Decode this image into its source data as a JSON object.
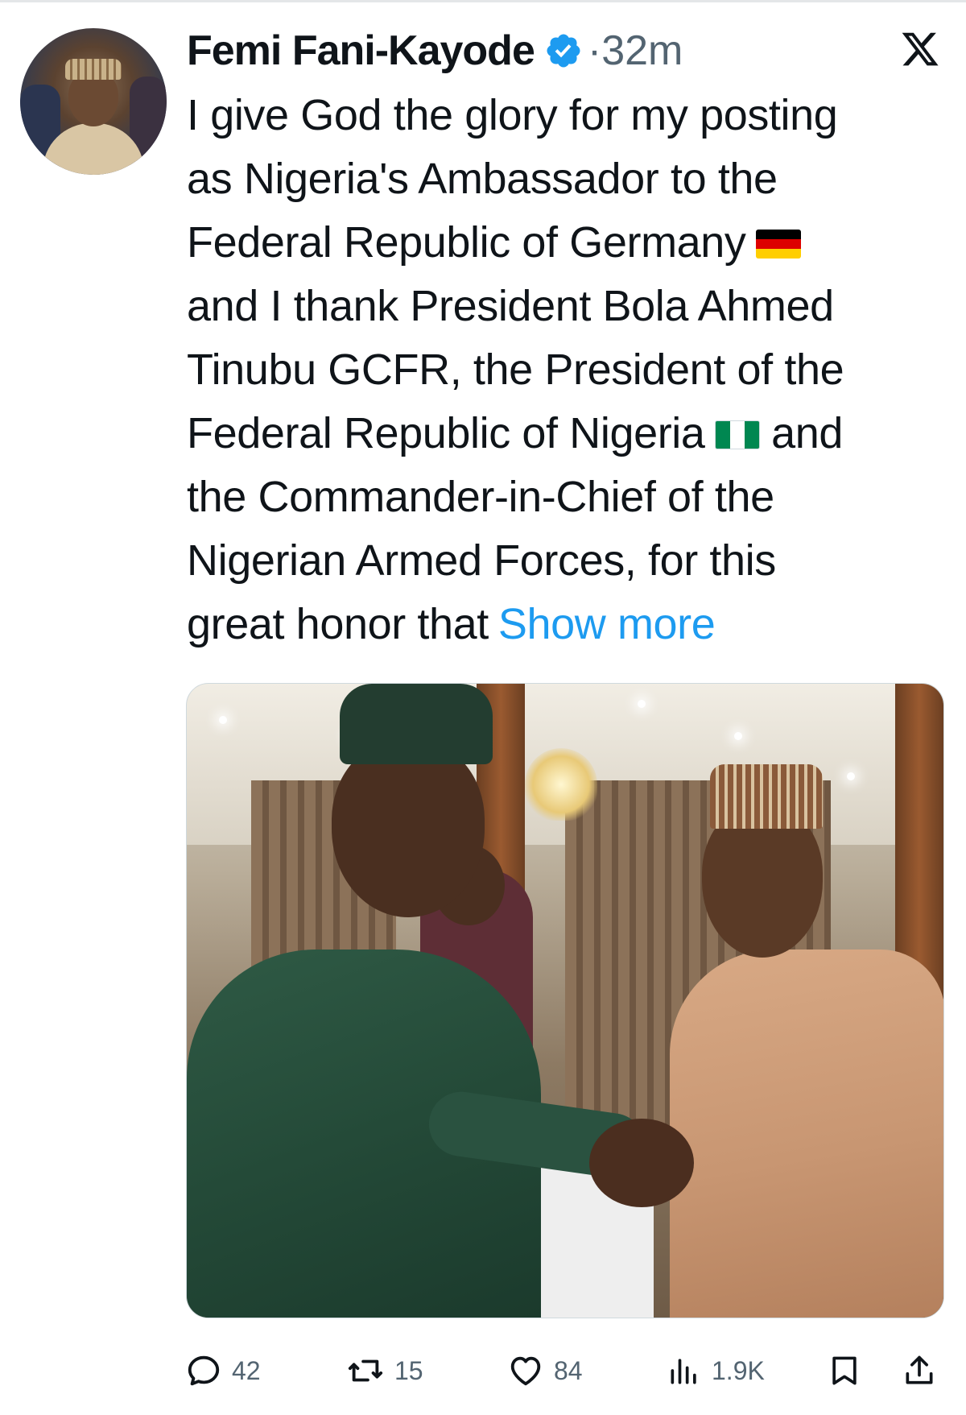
{
  "tweet": {
    "author_name": "Femi Fani-Kayode",
    "timestamp": "·32m",
    "text_lines": [
      "I give God the glory for my posting",
      "as Nigeria's Ambassador to the",
      "Federal Republic of Germany",
      "and I thank President Bola Ahmed",
      "Tinubu GCFR, the President of the",
      "Federal Republic of Nigeria",
      "and",
      "the Commander-in-Chief of the",
      "Nigerian Armed Forces, for this",
      "great honor that"
    ],
    "show_more": "Show more"
  },
  "actions": {
    "replies": "42",
    "reposts": "15",
    "likes": "84",
    "views": "1.9K"
  },
  "icons": {
    "verified": "verified-badge-icon",
    "platform": "x-logo-icon",
    "reply": "reply-icon",
    "repost": "repost-icon",
    "like": "heart-icon",
    "views": "views-icon",
    "bookmark": "bookmark-icon",
    "share": "share-icon"
  },
  "colors": {
    "accent": "#1d9bf0",
    "text": "#0f1419",
    "muted": "#536471"
  }
}
